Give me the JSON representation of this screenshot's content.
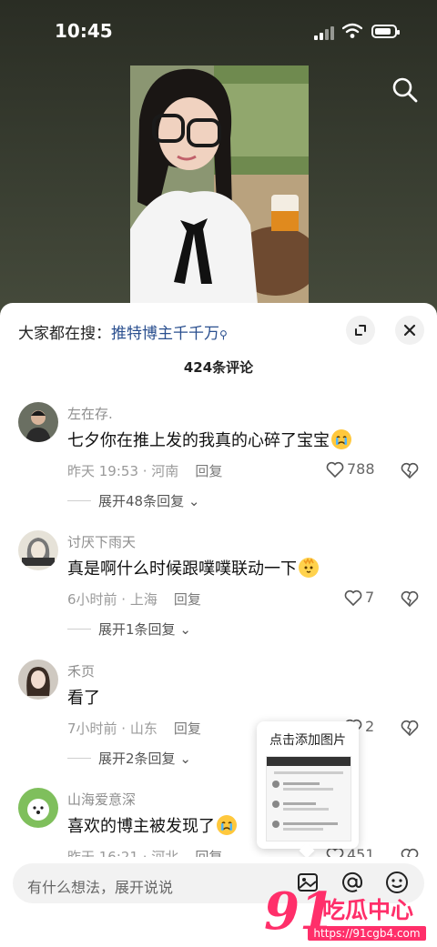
{
  "status_bar": {
    "time": "10:45"
  },
  "search_hint": {
    "prefix": "大家都在搜：",
    "keyword": "推特博主千千万"
  },
  "comments_count": "424条评论",
  "reply_label": "回复",
  "comments": [
    {
      "user": "左在存.",
      "text": "七夕你在推上发的我真的心碎了宝宝",
      "emoji": "crying-face",
      "time": "昨天 19:53 · 河南",
      "likes": "788",
      "expand": "展开48条回复"
    },
    {
      "user": "讨厌下雨天",
      "text": "真是啊什么时候跟噗噗联动一下",
      "emoji": "cute-face",
      "time": "6小时前 · 上海",
      "likes": "7",
      "expand": "展开1条回复"
    },
    {
      "user": "禾页",
      "text": "看了",
      "emoji": "",
      "time": "7小时前 · 山东",
      "likes": "2",
      "expand": "展开2条回复"
    },
    {
      "user": "山海爱意深",
      "text": "喜欢的博主被发现了",
      "emoji": "crying-face",
      "time": "昨天 16:21 · 河北",
      "likes": "451",
      "expand": ""
    }
  ],
  "popup": {
    "title": "点击添加图片"
  },
  "input": {
    "placeholder": "有什么想法，展开说说"
  },
  "watermark": {
    "number": "91",
    "text": "吃瓜中心",
    "url": "https://91cgb4.com"
  },
  "colors": {
    "accent_link": "#2a4f8f",
    "watermark": "#ff2f6a"
  }
}
